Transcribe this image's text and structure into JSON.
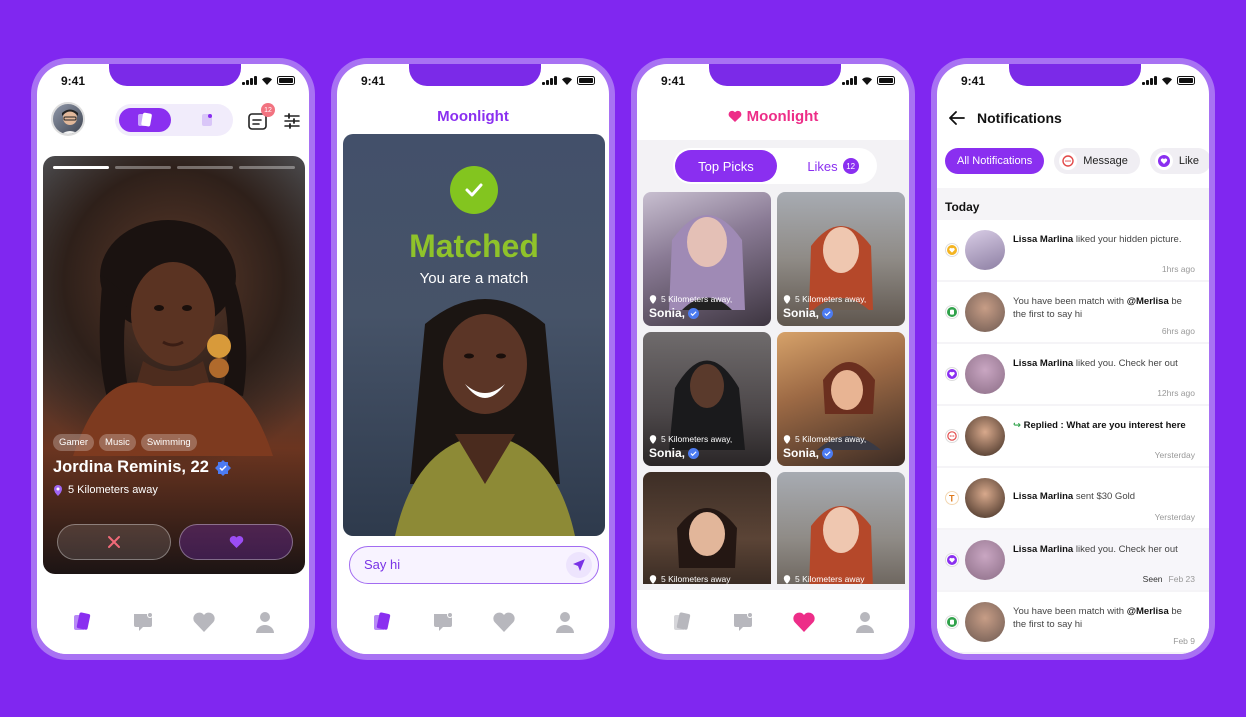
{
  "colors": {
    "background": "#8027f0",
    "accent": "#8a2ff0",
    "pink": "#ed2d88",
    "match_green": "#8fc32a"
  },
  "status_bar": {
    "time": "9:41"
  },
  "phone1": {
    "chat_badge": "12",
    "profile": {
      "tags": [
        "Gamer",
        "Music",
        "Swimming"
      ],
      "name": "Jordina Reminis, 22",
      "distance": "5 Kilometers away"
    }
  },
  "phone2": {
    "app_name": "Moonlight",
    "match_title": "Matched",
    "match_subtitle": "You are a match",
    "say_hi_placeholder": "Say hi"
  },
  "phone3": {
    "app_name": "Moonlight",
    "tabs": {
      "top_picks": "Top Picks",
      "likes": "Likes",
      "likes_count": "12"
    },
    "tiles": [
      {
        "distance": "5 Kilometers away,",
        "name": "Sonia,"
      },
      {
        "distance": "5 Kilometers away,",
        "name": "Sonia,"
      },
      {
        "distance": "5 Kilometers away,",
        "name": "Sonia,"
      },
      {
        "distance": "5 Kilometers away,",
        "name": "Sonia,"
      },
      {
        "distance": "5 Kilometers away",
        "name": ""
      },
      {
        "distance": "5 Kilometers away",
        "name": ""
      }
    ]
  },
  "phone4": {
    "title": "Notifications",
    "chips": [
      "All Notifications",
      "Message",
      "Like"
    ],
    "section": "Today",
    "items": [
      {
        "icon": "gold-heart-icon",
        "pre": "",
        "name": "Lissa Marlina",
        "text": " liked your hidden picture.",
        "time": "1hrs ago",
        "status": ""
      },
      {
        "icon": "match-icon",
        "pre": "You have been match with ",
        "name": "@Merlisa",
        "text": " be the first to say hi",
        "time": "6hrs ago",
        "status": ""
      },
      {
        "icon": "like-icon",
        "pre": "",
        "name": "Lissa Marlina",
        "text": " liked you. Check her out",
        "time": "12hrs ago",
        "status": ""
      },
      {
        "icon": "message-icon",
        "pre": "",
        "name": "Replied",
        "text": " : What are you interest here",
        "time": "Yersterday",
        "status": ""
      },
      {
        "icon": "gold-icon",
        "pre": "",
        "name": "Lissa Marlina",
        "text": " sent $30 Gold",
        "time": "Yersterday",
        "status": ""
      },
      {
        "icon": "like-icon",
        "pre": "",
        "name": "Lissa Marlina",
        "text": " liked you. Check her out",
        "time": "Feb 23",
        "status": "Seen"
      },
      {
        "icon": "match-icon",
        "pre": "You have been match with ",
        "name": "@Merlisa",
        "text": " be the first to say hi",
        "time": "Feb 9",
        "status": ""
      }
    ]
  }
}
